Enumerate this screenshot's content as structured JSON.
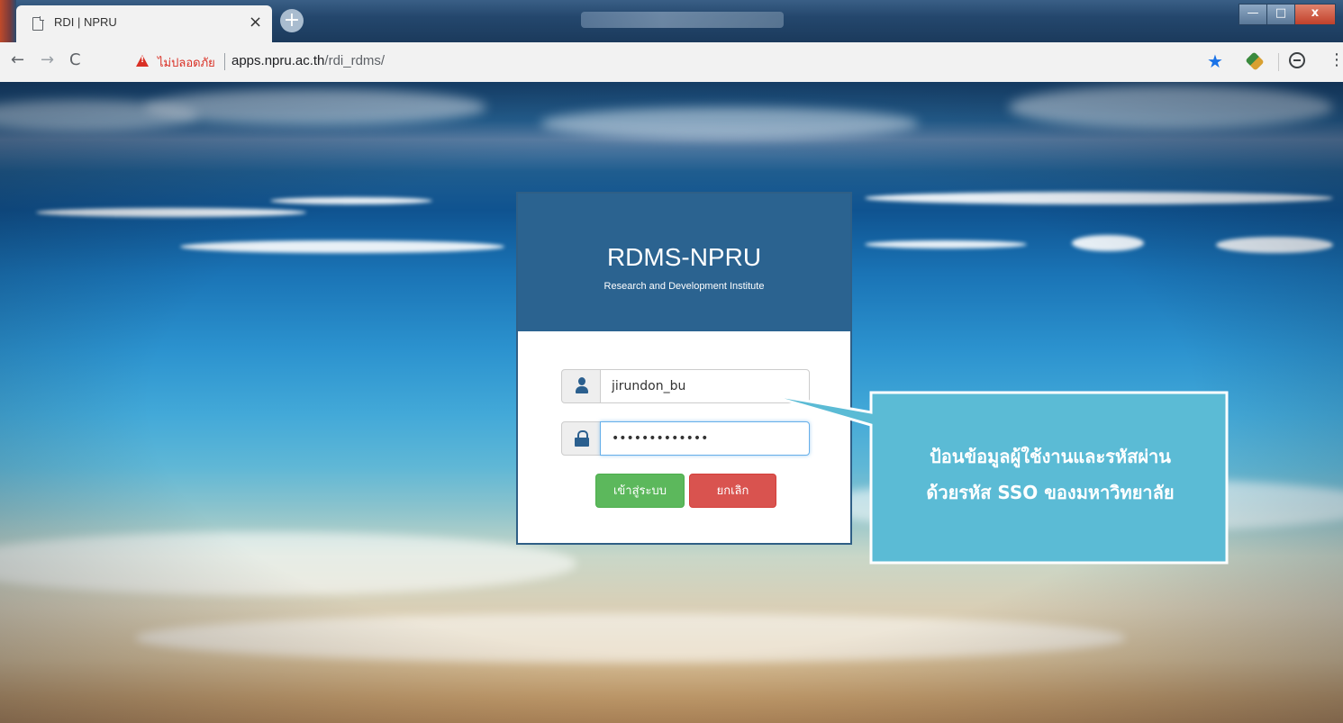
{
  "browser": {
    "tab_title": "RDI | NPRU",
    "tab_close": "×",
    "new_tab": "+",
    "window_minimize": "—",
    "window_maximize": "□",
    "window_close": "x",
    "nav_back": "←",
    "nav_forward": "→",
    "nav_reload": "C",
    "security_label": "ไม่ปลอดภัย",
    "url_host": "apps.npru.ac.th",
    "url_path": "/rdi_rdms/",
    "bookmark_star": "★",
    "menu": "⋮"
  },
  "login": {
    "brand": "RDMS-NPRU",
    "subtitle": "Research and Development Institute",
    "username_value": "jirundon_bu",
    "password_value": "•••••••••••••",
    "login_button": "เข้าสู่ระบบ",
    "cancel_button": "ยกเลิก"
  },
  "callout": {
    "line1": "ป้อนข้อมูลผู้ใช้งานและรหัสผ่าน",
    "line2": "ด้วยรหัส SSO ของมหาวิทยาลัย"
  },
  "colors": {
    "card_header": "#2b6390",
    "login_button": "#5cb85c",
    "cancel_button": "#d9534f",
    "callout_fill": "#5bbbd5",
    "callout_border": "#ffffff",
    "warning": "#d93025"
  }
}
